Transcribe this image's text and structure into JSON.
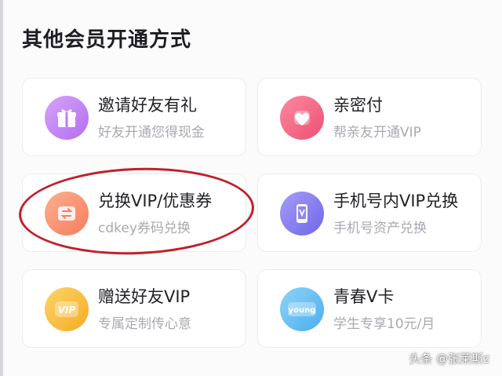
{
  "section": {
    "title": "其他会员开通方式"
  },
  "cards": [
    {
      "title": "邀请好友有礼",
      "subtitle": "好友开通您得现金",
      "icon": "gift-icon",
      "color": "#c07df0"
    },
    {
      "title": "亲密付",
      "subtitle": "帮亲友开通VIP",
      "icon": "heart-icon",
      "color": "#f45c7c"
    },
    {
      "title": "兑换VIP/优惠券",
      "subtitle": "cdkey券码兑换",
      "icon": "exchange-icon",
      "color": "#f9876a"
    },
    {
      "title": "手机号内VIP兑换",
      "subtitle": "手机号资产兑换",
      "icon": "phone-icon",
      "color": "#7f78f0"
    },
    {
      "title": "赠送好友VIP",
      "subtitle": "专属定制传心意",
      "icon": "vip-badge-icon",
      "color": "#f5b52e"
    },
    {
      "title": "青春V卡",
      "subtitle": "学生专享10元/月",
      "icon": "young-badge-icon",
      "color": "#5ab8f2",
      "badge_text": "young"
    }
  ],
  "watermark": "头条 @张莱斯z"
}
